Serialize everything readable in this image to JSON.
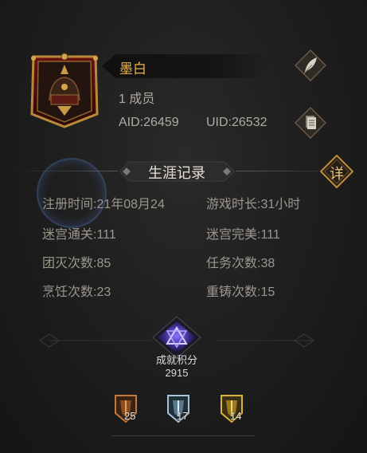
{
  "profile": {
    "name": "墨白",
    "members": "1 成员",
    "aid": "AID:26459",
    "uid": "UID:26532"
  },
  "section": {
    "title": "生涯记录",
    "detail_label": "详"
  },
  "stats": [
    {
      "label": "注册时间:",
      "value": "21年08月24"
    },
    {
      "label": "游戏时长:",
      "value": "31小时"
    },
    {
      "label": "迷宫通关:",
      "value": "111"
    },
    {
      "label": "迷宫完美:",
      "value": "111"
    },
    {
      "label": "团灭次数:",
      "value": "85"
    },
    {
      "label": "任务次数:",
      "value": "38"
    },
    {
      "label": "烹饪次数:",
      "value": "23"
    },
    {
      "label": "重铸次数:",
      "value": "15"
    }
  ],
  "achievement": {
    "label": "成就积分",
    "score": "2915"
  },
  "medals": [
    {
      "icon": "bronze-medal-icon",
      "count": "25",
      "color": "#c07a3a"
    },
    {
      "icon": "silver-medal-icon",
      "count": "17",
      "color": "#a9c3d8"
    },
    {
      "icon": "gold-medal-icon",
      "count": "14",
      "color": "#d9b43a"
    }
  ],
  "colors": {
    "accent": "#e8b34a",
    "text_muted": "#9c968c"
  }
}
